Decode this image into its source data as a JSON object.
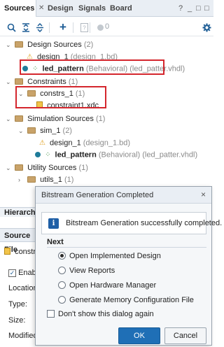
{
  "tabs": [
    {
      "label": "Sources",
      "active": true
    },
    {
      "label": "Design"
    },
    {
      "label": "Signals"
    },
    {
      "label": "Board"
    }
  ],
  "window_controls": {
    "help": "?",
    "minimize": "_",
    "restore": "□",
    "maximize": "□"
  },
  "toolbar": {
    "count": "0"
  },
  "tree": {
    "design_sources": {
      "label": "Design Sources",
      "count": "(2)"
    },
    "design_1": {
      "name": "design_1",
      "detail": "(design_1.bd)"
    },
    "led_pattern": {
      "name": "led_pattern",
      "detail": "(Behavioral) (led_patter.vhdl)"
    },
    "constraints": {
      "label": "Constraints",
      "count": "(1)"
    },
    "constrs_1": {
      "name": "constrs_1",
      "count": "(1)"
    },
    "constraint1": {
      "name": "constraint1.xdc"
    },
    "simulation_sources": {
      "label": "Simulation Sources",
      "count": "(1)"
    },
    "sim_1": {
      "name": "sim_1",
      "count": "(2)"
    },
    "sim_design_1": {
      "name": "design_1",
      "detail": "(design_1.bd)"
    },
    "sim_led_pattern": {
      "name": "led_pattern",
      "detail": "(Behavioral) (led_patter.vhdl)"
    },
    "utility_sources": {
      "label": "Utility Sources",
      "count": "(1)"
    },
    "utils_1": {
      "name": "utils_1",
      "count": "(1)"
    }
  },
  "lower": {
    "hierarchy_tab": "Hierarchy",
    "source_file_header": "Source File",
    "source_file_name": "constrain",
    "enable_label": "Enable",
    "props": [
      "Location:",
      "Type:",
      "Size:",
      "Modified:"
    ]
  },
  "dialog": {
    "title": "Bitstream Generation Completed",
    "close": "×",
    "message": "Bitstream Generation successfully completed.",
    "next_label": "Next",
    "options": [
      {
        "label": "Open Implemented Design",
        "selected": true
      },
      {
        "label": "View Reports",
        "selected": false
      },
      {
        "label": "Open Hardware Manager",
        "selected": false
      },
      {
        "label": "Generate Memory Configuration File",
        "selected": false
      }
    ],
    "dont_show": "Don't show this dialog again",
    "ok": "OK",
    "cancel": "Cancel"
  },
  "colors": {
    "accent": "#1f6fb6",
    "highlight_box": "#d4262d"
  }
}
